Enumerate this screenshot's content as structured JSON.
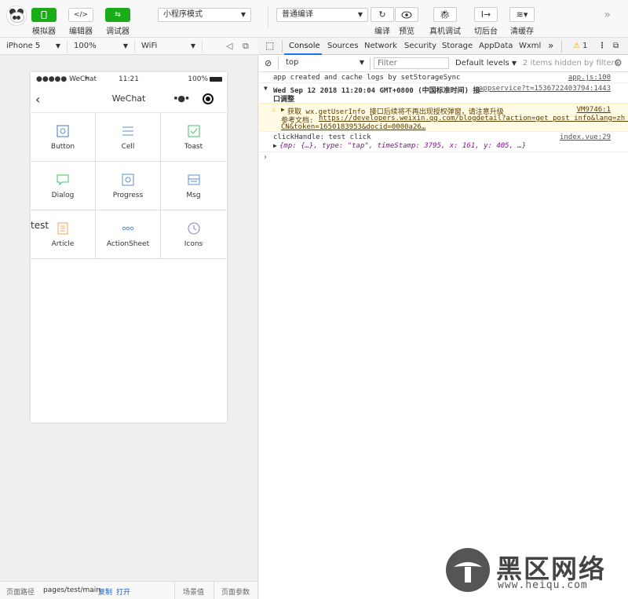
{
  "toolbar": {
    "simulator": "模拟器",
    "editor": "编辑器",
    "debugger": "调试器",
    "mode_select": "小程序模式",
    "compile_select": "普通编译",
    "compile": "编译",
    "preview": "预览",
    "remote_debug": "真机调试",
    "background": "切后台",
    "clear_cache": "清缓存",
    "more": "»"
  },
  "simulator": {
    "device": "iPhone 5",
    "zoom": "100%",
    "network": "WiFi"
  },
  "phone": {
    "status_left": "●●●●● WeChat",
    "time": "11:21",
    "battery": "100%",
    "nav_title": "WeChat",
    "grid": [
      {
        "label": "Button",
        "icon": "button-icon"
      },
      {
        "label": "Cell",
        "icon": "cell-icon"
      },
      {
        "label": "Toast",
        "icon": "toast-icon"
      },
      {
        "label": "Dialog",
        "icon": "dialog-icon"
      },
      {
        "label": "Progress",
        "icon": "progress-icon"
      },
      {
        "label": "Msg",
        "icon": "msg-icon"
      },
      {
        "label": "Article",
        "icon": "article-icon"
      },
      {
        "label": "ActionSheet",
        "icon": "actionsheet-icon"
      },
      {
        "label": "Icons",
        "icon": "icons-icon"
      }
    ],
    "test_text": "test"
  },
  "footer": {
    "path_label": "页面路径",
    "path": "pages/test/main",
    "copy": "复制",
    "open": "打开",
    "scene": "场景值",
    "params": "页面参数"
  },
  "devtools": {
    "tabs": [
      "Console",
      "Sources",
      "Network",
      "Security",
      "Storage",
      "AppData",
      "Wxml"
    ],
    "active_tab": "Console",
    "warning_count": "1",
    "context": "top",
    "filter_placeholder": "Filter",
    "levels": "Default levels",
    "hidden": "2 items hidden by filters",
    "logs": {
      "l1_text": "app created and cache logs by setStorageSync",
      "l1_src": "app.js:100",
      "l2_text": "Wed Sep 12 2018 11:20:04 GMT+0800 (中国标准时间) 接",
      "l2_text2": "口调整",
      "l2_src": "appservice?t=1536722403794:1443",
      "w_text": "获取 wx.getUserInfo 接口后续将不再出现授权弹窗，请注意升级",
      "w_src": "VM9746:1",
      "w_doc_label": "参考文档:",
      "w_doc_link": "https://developers.weixin.qq.com/blogdetail?action=get_post_info&lang=zh_",
      "w_doc_link2": "CN&token=1650183953&docid=0000a26…",
      "l3_text": "clickHandle: test click",
      "l3_src": "index.vue:29",
      "l3_obj": "{mp: {…}, type: \"tap\", timeStamp: 3795, x: 161, y: 405, …}"
    }
  },
  "watermark": {
    "cn": "黑区网络",
    "url": "www.heiqu.com"
  },
  "colors": {
    "green": "#1aad19",
    "link": "#1e5bb5",
    "warn_bg": "#fffbe5",
    "accent": "#1a73e8"
  }
}
